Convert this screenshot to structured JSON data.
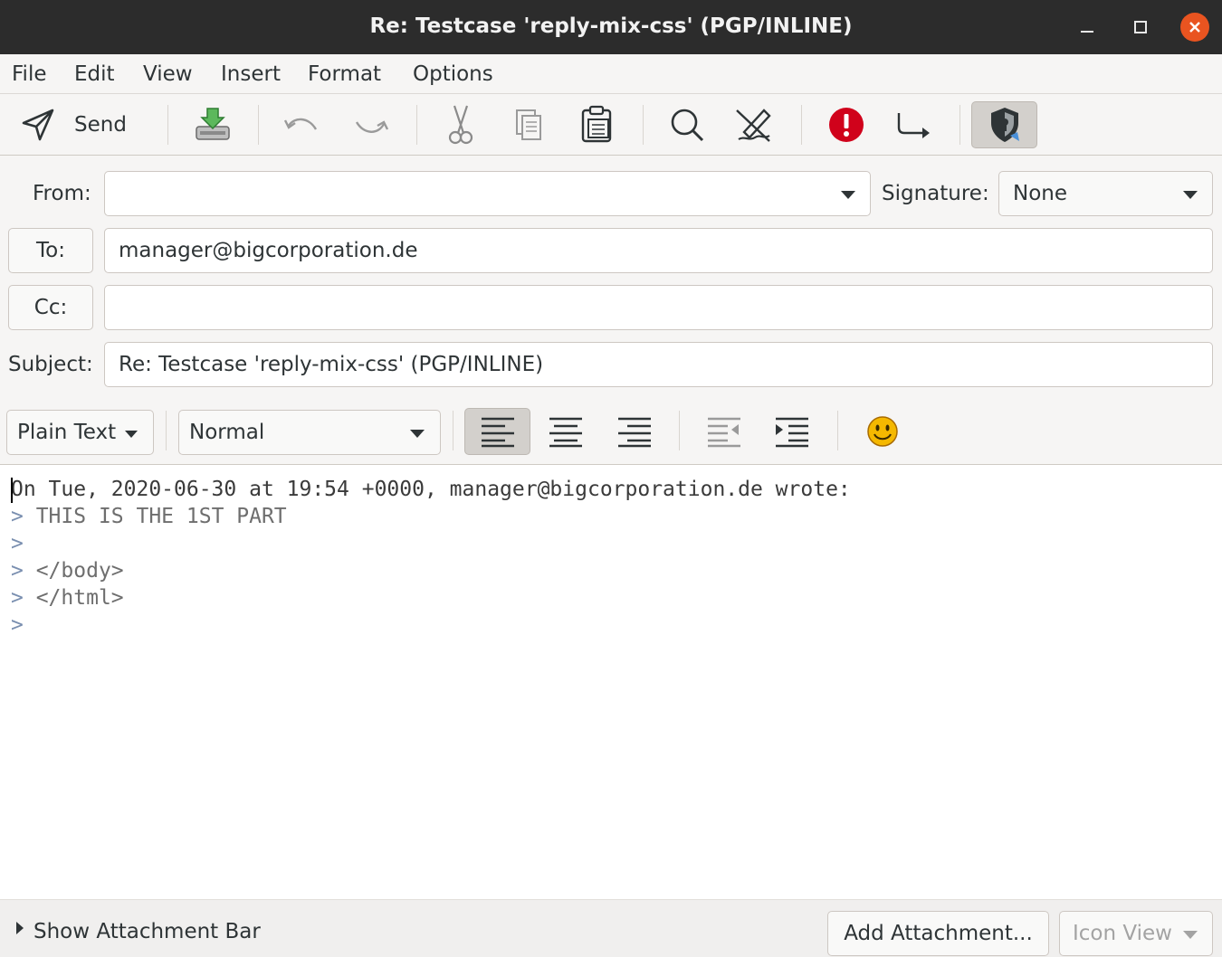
{
  "window": {
    "title": "Re: Testcase 'reply-mix-css' (PGP/INLINE)"
  },
  "menu": [
    "File",
    "Edit",
    "View",
    "Insert",
    "Format",
    "Options"
  ],
  "toolbar": {
    "send_label": "Send",
    "icons": [
      "send-icon",
      "save-icon",
      "undo-icon",
      "redo-icon",
      "cut-icon",
      "copy-icon",
      "paste-icon",
      "find-icon",
      "spellcheck-icon",
      "priority-icon",
      "return-receipt-icon",
      "security-shield-icon"
    ]
  },
  "header": {
    "from_label": "From:",
    "from_value": "",
    "signature_label": "Signature:",
    "signature_value": "None",
    "to_label": "To:",
    "to_value": "manager@bigcorporation.de",
    "cc_label": "Cc:",
    "cc_value": "",
    "subject_label": "Subject:",
    "subject_value": "Re: Testcase 'reply-mix-css' (PGP/INLINE)"
  },
  "format": {
    "mode": "Plain Text",
    "paragraph": "Normal"
  },
  "body": {
    "lines": [
      {
        "prefix": "",
        "text": "On Tue, 2020-06-30 at 19:54 +0000, manager@bigcorporation.de wrote:"
      },
      {
        "prefix": ">",
        "text": " THIS IS THE 1ST PART"
      },
      {
        "prefix": ">",
        "text": ""
      },
      {
        "prefix": ">",
        "text": " </body>"
      },
      {
        "prefix": ">",
        "text": " </html>"
      },
      {
        "prefix": ">",
        "text": ""
      }
    ]
  },
  "bottom": {
    "show_attachment": "Show Attachment Bar",
    "add_attachment": "Add Attachment...",
    "icon_view": "Icon View"
  },
  "colors": {
    "titlebar": "#2c2c2c",
    "close": "#e95420",
    "priority": "#d0021b"
  }
}
